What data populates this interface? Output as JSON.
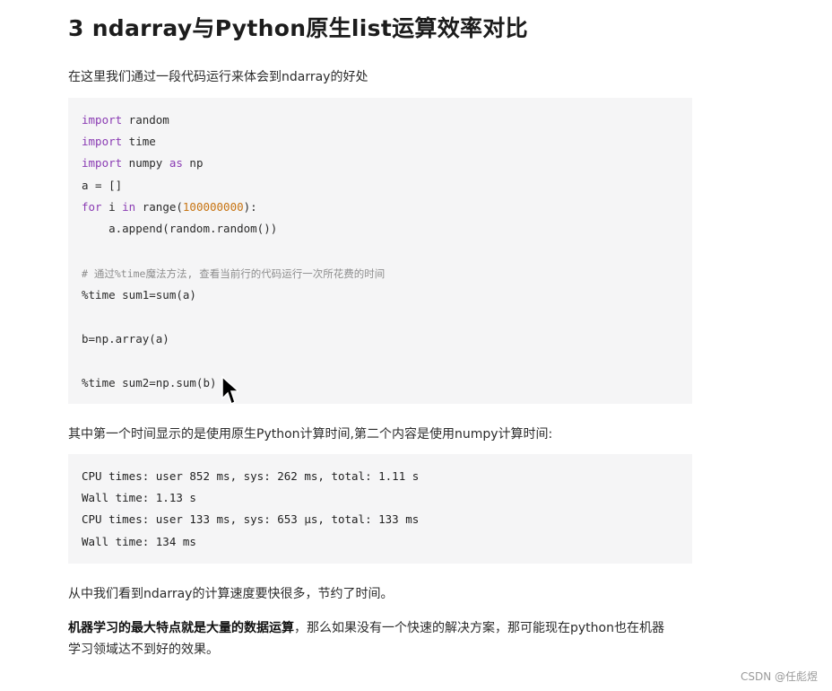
{
  "heading": "3 ndarray与Python原生list运算效率对比",
  "intro": "在这里我们通过一段代码运行来体会到ndarray的好处",
  "code": {
    "l1_kw": "import",
    "l1_rest": " random",
    "l2_kw": "import",
    "l2_rest": " time",
    "l3_kw": "import",
    "l3_mid": " numpy ",
    "l3_kw2": "as",
    "l3_rest": " np",
    "l4": "a = []",
    "l5_kw": "for",
    "l5_a": " i ",
    "l5_kw2": "in",
    "l5_b": " range(",
    "l5_num": "100000000",
    "l5_c": "):",
    "l6": "    a.append(random.random())",
    "comment": "# 通过%time魔法方法, 查看当前行的代码运行一次所花费的时间",
    "l7": "%time sum1=sum(a)",
    "l8": "b=np.array(a)",
    "l9": "%time sum2=np.sum(b)"
  },
  "explain": "其中第一个时间显示的是使用原生Python计算时间,第二个内容是使用numpy计算时间:",
  "output": [
    "CPU times: user 852 ms, sys: 262 ms, total: 1.11 s",
    "Wall time: 1.13 s",
    "CPU times: user 133 ms, sys: 653 µs, total: 133 ms",
    "Wall time: 134 ms"
  ],
  "conclusion": "从中我们看到ndarray的计算速度要快很多，节约了时间。",
  "final_bold": "机器学习的最大特点就是大量的数据运算",
  "final_rest": "，那么如果没有一个快速的解决方案，那可能现在python也在机器",
  "final_line2": "学习领域达不到好的效果。",
  "watermark": "CSDN @任彪煜",
  "icons": {
    "cursor": "mouse-pointer-icon"
  }
}
